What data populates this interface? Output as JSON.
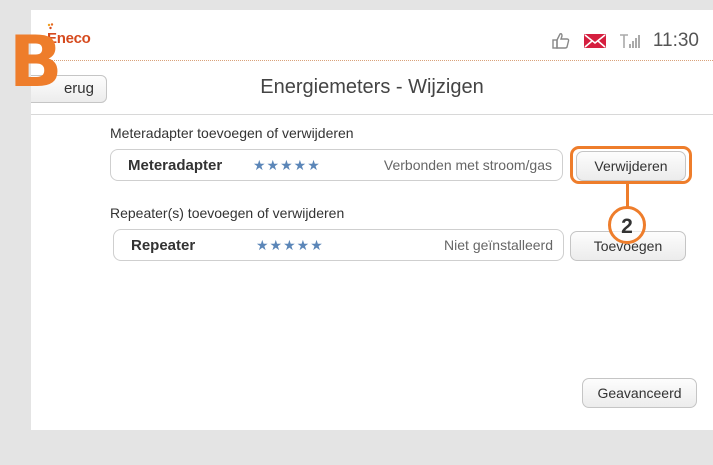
{
  "statusbar": {
    "brand": "Eneco",
    "time": "11:30",
    "icons": [
      "thumbs-up-icon",
      "mail-icon",
      "signal-icon"
    ],
    "brand_color": "#d64a1e"
  },
  "titlebar": {
    "back_label": "erug",
    "title": "Energiemeters - Wijzigen"
  },
  "meteradapter": {
    "section_label": "Meteradapter toevoegen of verwijderen",
    "name": "Meteradapter",
    "stars": "★★★★★",
    "status": "Verbonden met stroom/gas",
    "action_label": "Verwijderen"
  },
  "repeater": {
    "section_label": "Repeater(s) toevoegen of verwijderen",
    "name": "Repeater",
    "stars": "★★★★★",
    "status": "Niet geïnstalleerd",
    "action_label": "Toevoegen"
  },
  "advanced_label": "Geavanceerd",
  "annotations": {
    "step_letter": "B",
    "step_number": "2",
    "accent_color": "#ee7d2b"
  }
}
